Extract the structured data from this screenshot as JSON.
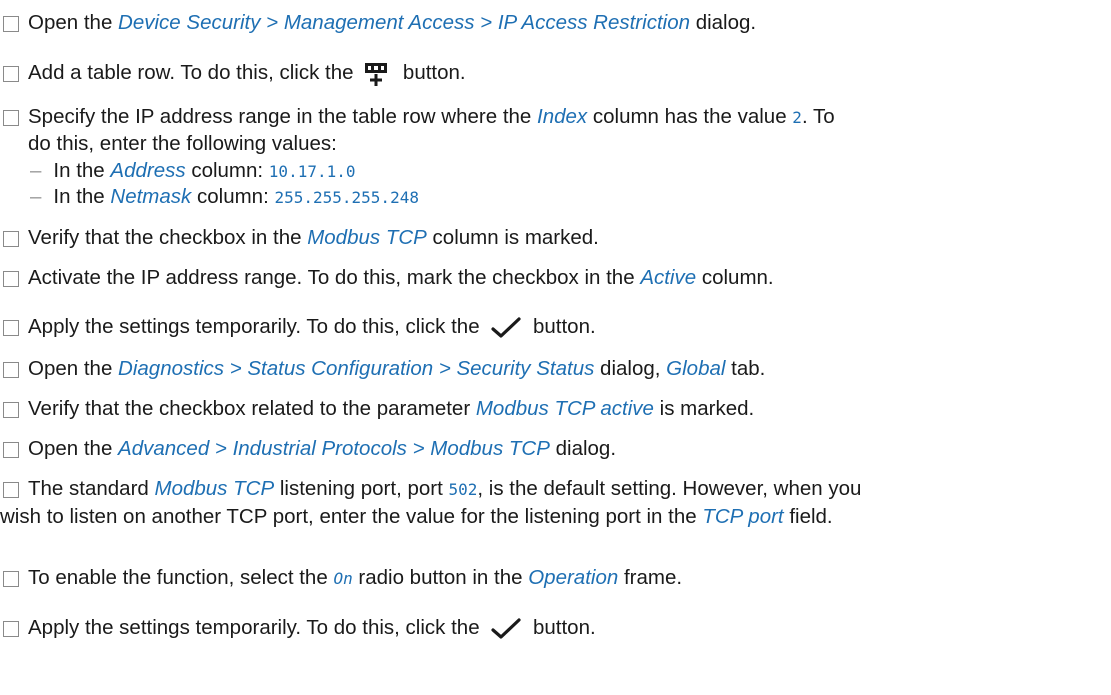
{
  "steps": [
    {
      "before": "Open the ",
      "path": "Device Security > Management Access > IP Access Restriction",
      "after": " dialog."
    },
    {
      "before": "Add a table row. To do this, click the ",
      "icon": "add-table-row-icon",
      "after": " button."
    },
    {
      "line1_before": "Specify the IP address range in the table row where the ",
      "col": "Index",
      "line1_mid": " column has the value ",
      "value": "2",
      "line1_after": ". To",
      "line2": "do this, enter the following values:",
      "subitems": [
        {
          "dash": "–",
          "before": "In the ",
          "col": "Address",
          "after": " column: ",
          "value": "10.17.1.0"
        },
        {
          "dash": "–",
          "before": "In the ",
          "col": "Netmask",
          "after": " column: ",
          "value": "255.255.255.248"
        }
      ]
    },
    {
      "before": "Verify that the checkbox in the ",
      "col": "Modbus TCP",
      "after": " column is marked."
    },
    {
      "before": "Activate the IP address range. To do this, mark the checkbox in the ",
      "col": "Active",
      "after": " column."
    },
    {
      "before": "Apply the settings temporarily. To do this, click the ",
      "icon": "checkmark-icon",
      "after": " button."
    },
    {
      "before": "Open the ",
      "path": "Diagnostics > Status Configuration > Security Status",
      "mid": " dialog, ",
      "tab": "Global",
      "after": " tab."
    },
    {
      "before": "Verify that the checkbox related to the parameter ",
      "param": "Modbus TCP active",
      "after": " is marked."
    },
    {
      "before": "Open the ",
      "path": "Advanced > Industrial Protocols > Modbus TCP",
      "after": " dialog."
    },
    {
      "line1_before": "The standard ",
      "proto": "Modbus TCP",
      "line1_mid": " listening port, port ",
      "port": "502",
      "line1_after": ", is the default setting. However, when you",
      "line2_before": "wish to listen on another TCP port, enter the value for the listening port in the ",
      "field": "TCP port",
      "line2_after": " field."
    },
    {
      "before": "To enable the function, select the ",
      "radio": "On",
      "mid": " radio button in the ",
      "frame": "Operation",
      "after": " frame."
    },
    {
      "before": "Apply the settings temporarily. To do this, click the ",
      "icon": "checkmark-icon",
      "after": " button."
    }
  ]
}
